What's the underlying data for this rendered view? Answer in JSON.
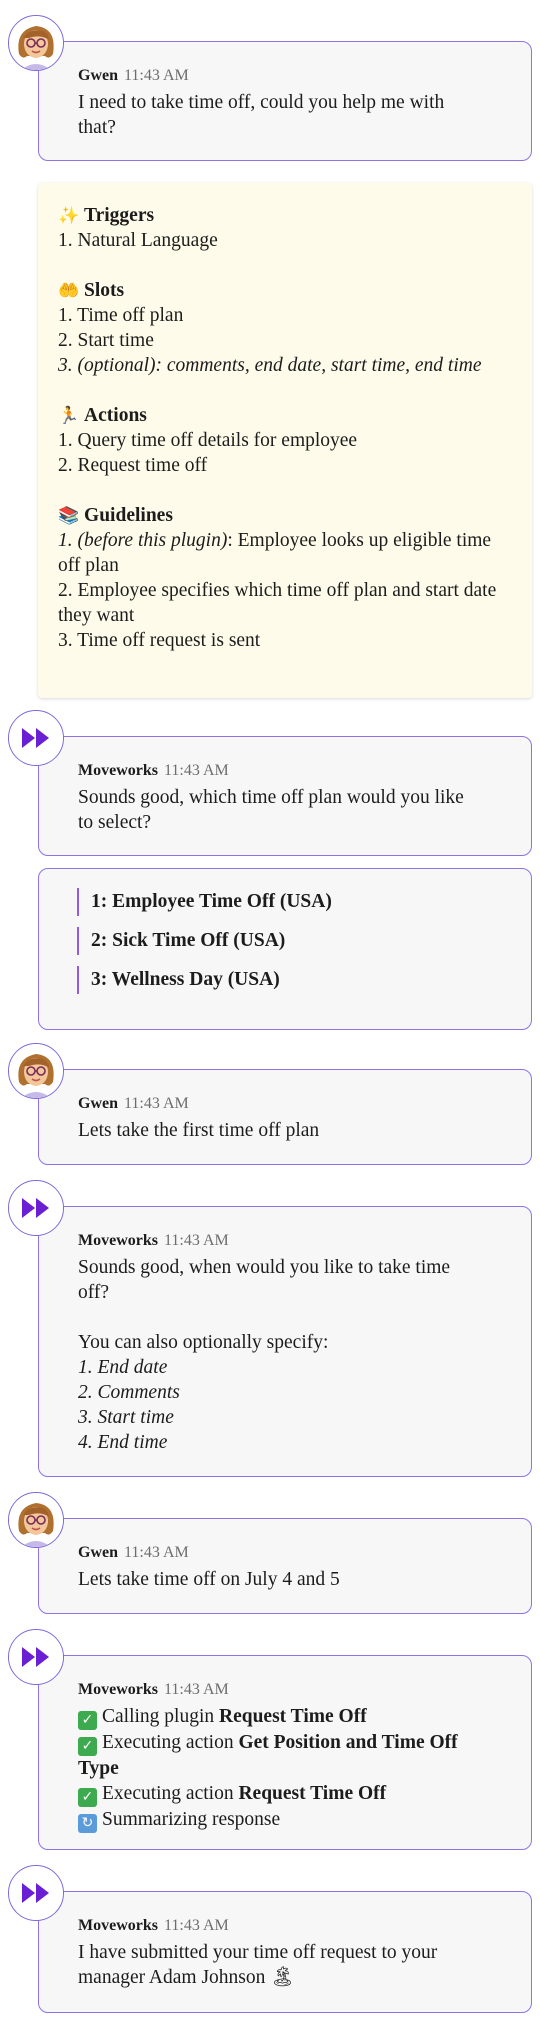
{
  "messages": {
    "m1": {
      "name": "Gwen",
      "time": "11:43 AM",
      "l1": "I need to take time off, could you help me with",
      "l2": "that?"
    },
    "m2": {
      "name": "Moveworks",
      "time": "11:43 AM",
      "l1": "Sounds good, which time off plan would you like",
      "l2": "to select?"
    },
    "m3": {
      "name": "Gwen",
      "time": "11:43 AM",
      "l1": "Lets take the first time off plan"
    },
    "m4": {
      "name": "Moveworks",
      "time": "11:43 AM",
      "l1": "Sounds good, when would you like to take time",
      "l2": "off?",
      "l3": "You can also optionally specify:",
      "i1": "1. End date",
      "i2": "2. Comments",
      "i3": "3. Start time",
      "i4": "4. End time"
    },
    "m5": {
      "name": "Gwen",
      "time": "11:43 AM",
      "l1": "Lets take time off on July 4 and 5"
    },
    "m6": {
      "name": "Moveworks",
      "time": "11:43 AM",
      "s1a": "Calling plugin ",
      "s1b": "Request Time Off",
      "s2a": "Executing action ",
      "s2b": "Get Position and Time Off",
      "s2c": "Type",
      "s3a": "Executing action ",
      "s3b": "Request Time Off",
      "s4a": "Summarizing response"
    },
    "m7": {
      "name": "Moveworks",
      "time": "11:43 AM",
      "l1": "I have submitted your time off request to your",
      "l2": "manager Adam Johnson"
    }
  },
  "plugin": {
    "triggers": {
      "title": "Triggers",
      "items": [
        "1. Natural Language"
      ]
    },
    "slots": {
      "title": "Slots",
      "i1": "1. Time off plan",
      "i2": "2. Start time",
      "i3": "3. (optional): comments, end date, start time, end time"
    },
    "actions": {
      "title": "Actions",
      "i1": "1. Query time off details for employee",
      "i2": "2. Request time off"
    },
    "guidelines": {
      "title": "Guidelines",
      "g1a": "1. (before this plugin)",
      "g1b": ": Employee looks up eligible time",
      "g1c": "off plan",
      "g2a": "2. Employee specifies which time off plan and start date",
      "g2b": "they want",
      "g3": "3. Time off request is sent"
    }
  },
  "options": [
    "1: Employee Time Off (USA)",
    "2: Sick Time Off (USA)",
    "3: Wellness Day (USA)"
  ],
  "colors": {
    "border": "#8f72e6",
    "card": "#f7f7f8",
    "plugin_bg": "#fefbea",
    "moveworks": "#6a1fd4"
  }
}
